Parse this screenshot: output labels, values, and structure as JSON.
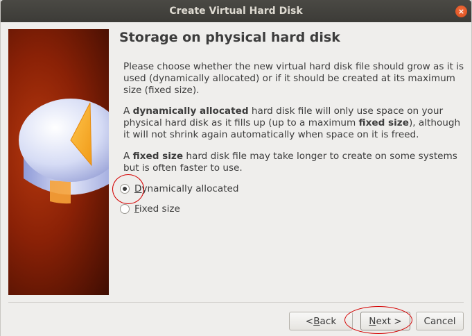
{
  "window": {
    "title": "Create Virtual Hard Disk",
    "close_glyph": "×"
  },
  "page": {
    "title": "Storage on physical hard disk",
    "paragraph1": "Please choose whether the new virtual hard disk file should grow as it is used (dynamically allocated) or if it should be created at its maximum size (fixed size).",
    "paragraph2": {
      "pre": "A ",
      "bold1": "dynamically allocated",
      "mid": " hard disk file will only use space on your physical hard disk as it fills up (up to a maximum ",
      "bold2": "fixed size",
      "post": "), although it will not shrink again automatically when space on it is freed."
    },
    "paragraph3": {
      "pre": "A ",
      "bold": "fixed size",
      "post": " hard disk file may take longer to create on some systems but is often faster to use."
    }
  },
  "options": [
    {
      "mnemonic": "D",
      "rest": "ynamically allocated",
      "checked": true
    },
    {
      "mnemonic": "F",
      "rest": "ixed size",
      "checked": false
    }
  ],
  "buttons": {
    "back": {
      "prefix": "< ",
      "mnemonic": "B",
      "rest": "ack"
    },
    "next": {
      "mnemonic": "N",
      "rest": "ext >"
    },
    "cancel": {
      "label": "Cancel"
    }
  },
  "colors": {
    "titlebar": "#3c3b37",
    "dialog_background": "#efeeec",
    "close_button": "#e25a27",
    "annotation": "#d40000",
    "side_image": "#8a2106"
  },
  "icons": {
    "close": "close-icon",
    "side_image": "virtualbox-hard-disk-illustration"
  }
}
